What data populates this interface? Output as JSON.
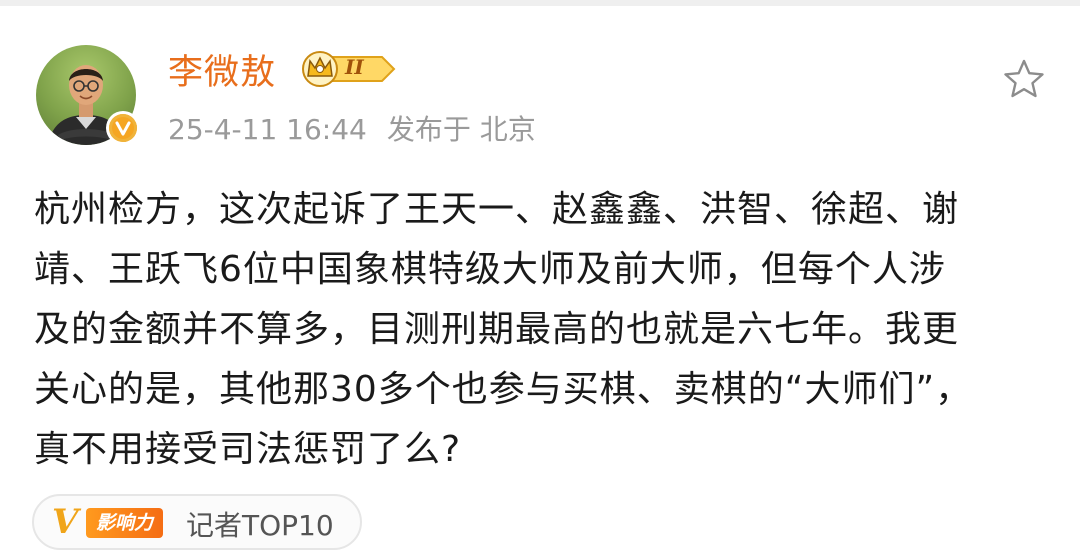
{
  "post": {
    "author": {
      "name": "李微敖",
      "level_badge": "II"
    },
    "meta": {
      "timestamp": "25-4-11 16:44",
      "location": "发布于 北京"
    },
    "text_lines": [
      "杭州检方，这次起诉了王天一、赵鑫鑫、洪智、徐超、谢",
      "靖、王跃飞6位中国象棋特级大师及前大师，但每个人涉",
      "及的金额并不算多，目测刑期最高的也就是六七年。我更",
      "关心的是，其他那30多个也参与买棋、卖棋的“大师们”，",
      "真不用接受司法惩罚了么?"
    ],
    "tag": {
      "icon_letter": "V",
      "badge_label": "影响力",
      "label": "记者TOP10"
    }
  },
  "colors": {
    "username": "#e86e1c",
    "meta": "#9a9a9a",
    "verified": "#f5a623",
    "influence": "#f56d14"
  }
}
